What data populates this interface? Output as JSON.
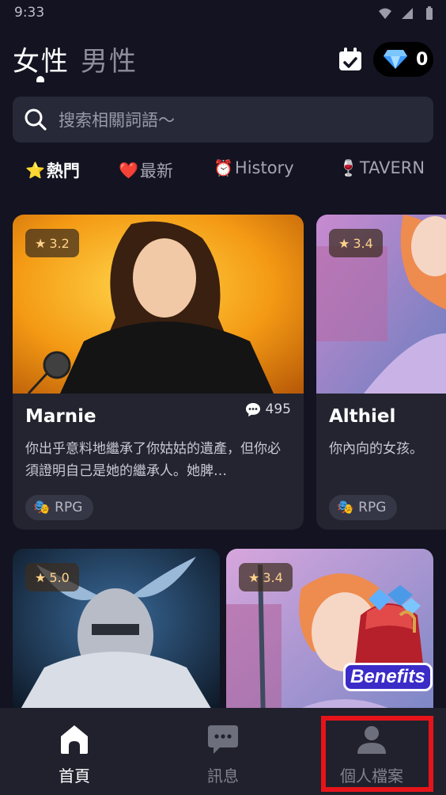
{
  "status_bar": {
    "time": "9:33"
  },
  "header": {
    "gender_tabs": [
      {
        "label": "女性"
      },
      {
        "label": "男性"
      }
    ],
    "gem_count": "0"
  },
  "search": {
    "placeholder": "搜索相關詞語～"
  },
  "categories": [
    {
      "icon": "⭐",
      "label": "熱門"
    },
    {
      "icon": "❤️",
      "label": "最新"
    },
    {
      "icon": "⏰",
      "label": "History"
    },
    {
      "icon": "🍷",
      "label": "TAVERN"
    }
  ],
  "cards": [
    {
      "rating": "3.2",
      "name": "Marnie",
      "chat_count": "495",
      "description": "你出乎意料地繼承了你姑姑的遺產，但你必須證明自己是她的繼承人。她脾…",
      "tag": "RPG"
    },
    {
      "rating": "3.4",
      "name": "Althiel",
      "description": "你內向的女孩。",
      "tag": "RPG"
    },
    {
      "rating": "5.0"
    },
    {
      "rating": "3.4",
      "badge": "Benefits"
    }
  ],
  "bottom_nav": [
    {
      "label": "首頁"
    },
    {
      "label": "訊息"
    },
    {
      "label": "個人檔案"
    }
  ],
  "colors": {
    "background": "#131321",
    "card": "#23242f",
    "nav": "#20212c",
    "highlight": "#e6141a"
  }
}
